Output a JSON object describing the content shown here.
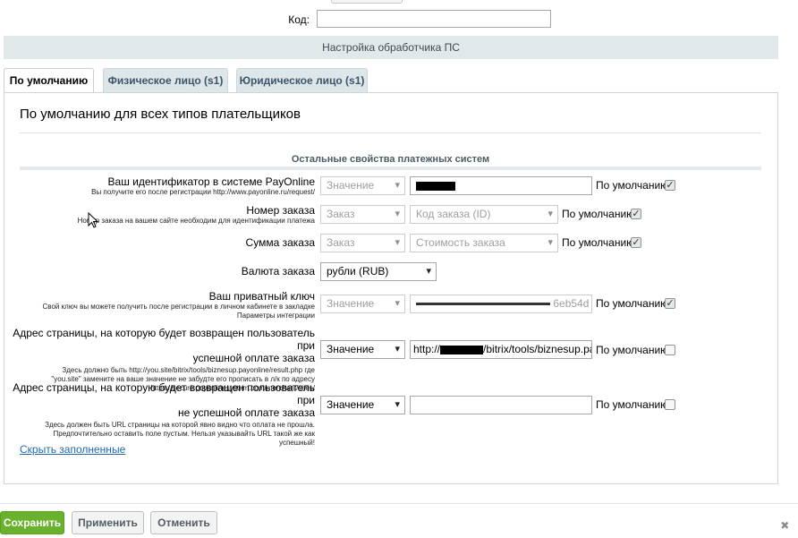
{
  "top": {
    "code_label": "Код:",
    "code_value": ""
  },
  "section_title": "Настройка обработчика ПС",
  "tabs": [
    {
      "label": "По умолчанию",
      "active": true
    },
    {
      "label": "Физическое лицо (s1)",
      "active": false
    },
    {
      "label": "Юридическое лицо (s1)",
      "active": false
    }
  ],
  "panel": {
    "title": "По умолчанию для всех типов плательщиков",
    "subheading": "Остальные свойства платежных систем"
  },
  "default_label": "По умолчанию",
  "fields": [
    {
      "label": "Ваш идентификатор в системе PayOnline",
      "hint": "Вы получите его после регистрации http://www.payonline.ru/request/",
      "type_value": "Значение",
      "value": "",
      "is_default": true
    },
    {
      "label": "Номер заказа",
      "hint": "Номер заказа на вашем сайте необходим для идентификации платежа",
      "type_value": "Заказ",
      "value": "Код заказа (ID)",
      "is_default": true
    },
    {
      "label": "Сумма заказа",
      "type_value": "Заказ",
      "value": "Стоимость заказа",
      "is_default": true
    },
    {
      "label": "Валюта заказа",
      "value": "рубли (RUB)"
    },
    {
      "label": "Ваш приватный ключ",
      "hint_lines": [
        "Свой ключ вы можете получить после регистрации в личном кабинете в закладке",
        "Параметры интеграции"
      ],
      "type_value": "Значение",
      "value_suffix": "6eb54d",
      "is_default": true
    },
    {
      "label_lines": [
        "Адрес страницы, на которую будет возвращен пользователь при",
        "успешной оплате заказа"
      ],
      "hint_lines": [
        "Здесь должно быть http://you.site/bitrix/tools/biznesup.payonline/result.php где",
        "\"you.site\" замените на ваше значение не забудте его прописать в л/к по адресу",
        "https://secure.payonlinesystem.com/merchant/sites/"
      ],
      "type_value": "Значение",
      "value_prefix": "http://",
      "value_suffix": "/bitrix/tools/biznesup.pay",
      "is_default": false
    },
    {
      "label_lines": [
        "Адрес страницы, на которую будет возвращен пользователь при",
        "не успешной оплате заказа"
      ],
      "hint_lines": [
        "Здесь должен быть URL страницы на которой явно видно что оплата не прошла.",
        "Предпочтительно оставить поле пустым. Нельзя указывайть URL такой же как",
        "успешный!"
      ],
      "type_value": "Значение",
      "value": "",
      "is_default": false
    }
  ],
  "hide_link": "Скрыть заполненные",
  "buttons": {
    "save": "Сохранить",
    "apply": "Применить",
    "cancel": "Отменить"
  },
  "colors": {
    "tab_bg": "#dde6e9",
    "section_bg": "#e0e8ea",
    "save_bg": "#6ab22e",
    "link": "#2067b0"
  }
}
